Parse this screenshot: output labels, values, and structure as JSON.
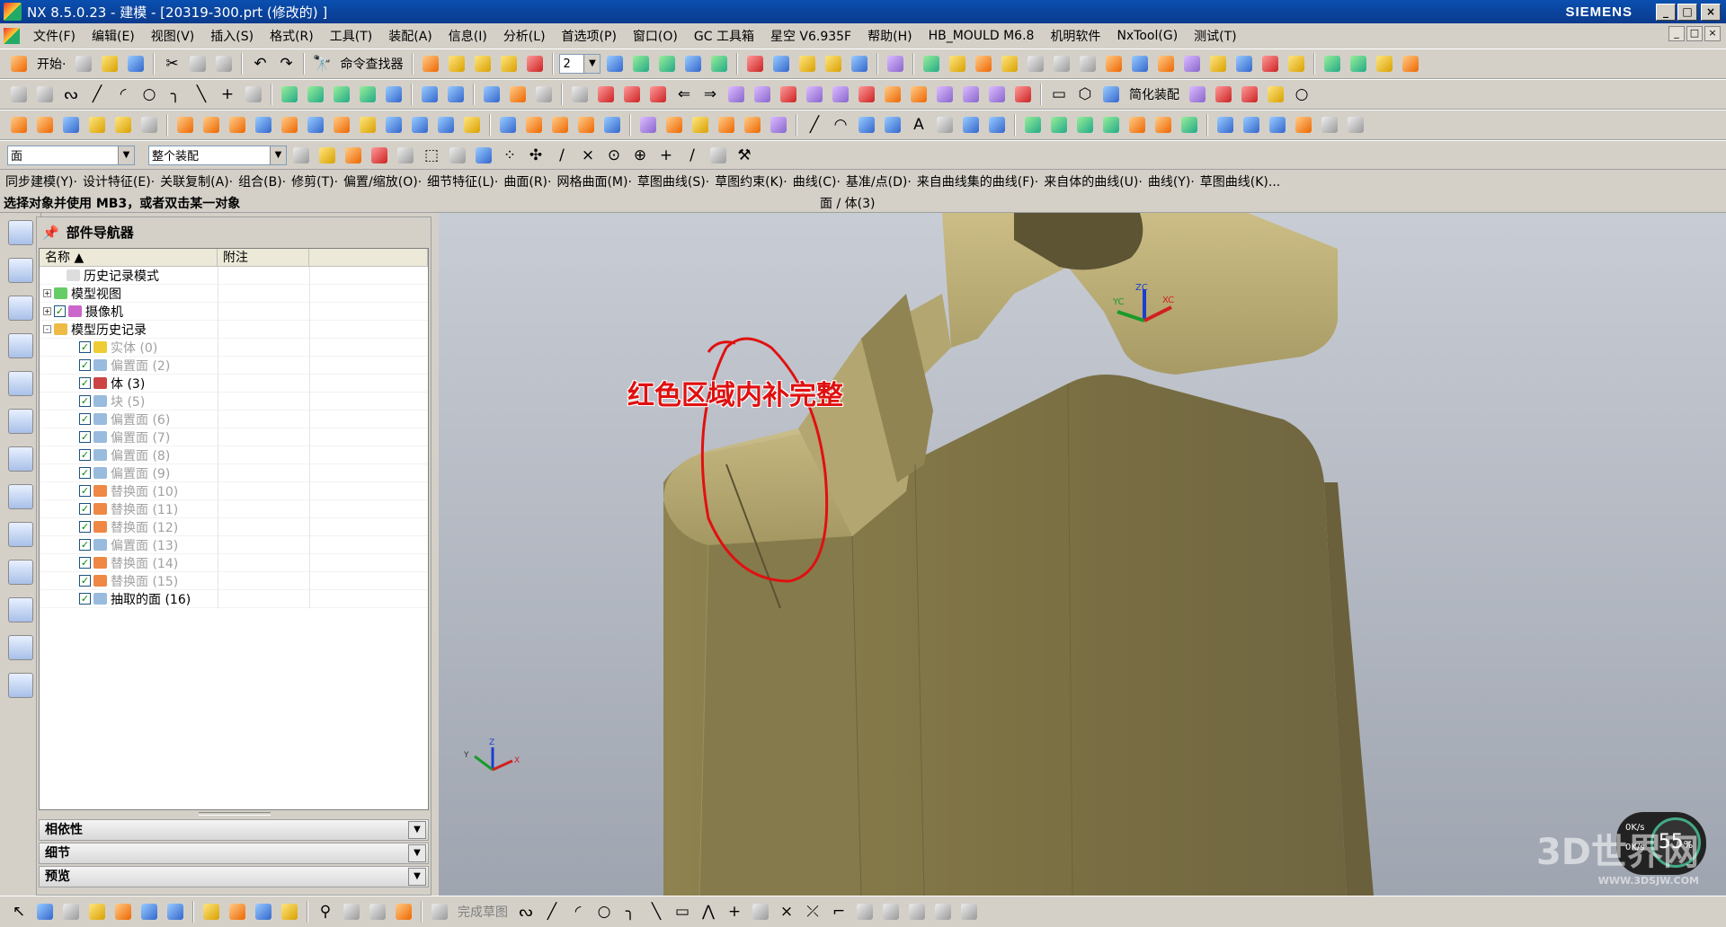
{
  "window": {
    "title": "NX 8.5.0.23 - 建模 - [20319-300.prt (修改的) ]",
    "brand": "SIEMENS",
    "buttons": [
      "_",
      "□",
      "×"
    ]
  },
  "menubar": {
    "items": [
      "文件(F)",
      "编辑(E)",
      "视图(V)",
      "插入(S)",
      "格式(R)",
      "工具(T)",
      "装配(A)",
      "信息(I)",
      "分析(L)",
      "首选项(P)",
      "窗口(O)",
      "GC 工具箱",
      "星空 V6.935F",
      "帮助(H)",
      "HB_MOULD M6.8",
      "机明软件",
      "NxTool(G)",
      "测试(T)"
    ]
  },
  "toolbar1": {
    "start_label": "开始·",
    "command_finder": "命令查找器",
    "layer_value": "2"
  },
  "toolbar2": {
    "simplify_label": "简化装配"
  },
  "filterbar": {
    "type_filter": "面",
    "scope_filter": "整个装配"
  },
  "command_groups": [
    "同步建模(Y)·",
    "设计特征(E)·",
    "关联复制(A)·",
    "组合(B)·",
    "修剪(T)·",
    "偏置/缩放(O)·",
    "细节特征(L)·",
    "曲面(R)·",
    "网格曲面(M)·",
    "草图曲线(S)·",
    "草图约束(K)·",
    "曲线(C)·",
    "基准/点(D)·",
    "来自曲线集的曲线(F)·",
    "来自体的曲线(U)·",
    "曲线(Y)·",
    "草图曲线(K)..."
  ],
  "status": {
    "prompt": "选择对象并使用 MB3，或者双击某一对象",
    "selection": "面 / 体(3)"
  },
  "navigator": {
    "title": "部件导航器",
    "columns": [
      "名称",
      "附注"
    ],
    "rows": [
      {
        "label": "历史记录模式",
        "indent": 1,
        "check": false,
        "icon": "clock-icon",
        "dim": false
      },
      {
        "label": "模型视图",
        "indent": 0,
        "check": false,
        "icon": "model-view-icon",
        "dim": false,
        "expand": "+"
      },
      {
        "label": "摄像机",
        "indent": 0,
        "check": true,
        "icon": "camera-icon",
        "dim": false,
        "expand": "+"
      },
      {
        "label": "模型历史记录",
        "indent": 0,
        "check": false,
        "icon": "folder-icon",
        "dim": false,
        "expand": "-"
      },
      {
        "label": "实体 (0)",
        "indent": 2,
        "check": true,
        "icon": "solid-icon",
        "dim": true
      },
      {
        "label": "偏置面 (2)",
        "indent": 2,
        "check": true,
        "icon": "offset-face-icon",
        "dim": true
      },
      {
        "label": "体 (3)",
        "indent": 2,
        "check": true,
        "icon": "body-icon",
        "dim": false
      },
      {
        "label": "块 (5)",
        "indent": 2,
        "check": true,
        "icon": "block-icon",
        "dim": true
      },
      {
        "label": "偏置面 (6)",
        "indent": 2,
        "check": true,
        "icon": "offset-face-icon",
        "dim": true
      },
      {
        "label": "偏置面 (7)",
        "indent": 2,
        "check": true,
        "icon": "offset-face-icon",
        "dim": true
      },
      {
        "label": "偏置面 (8)",
        "indent": 2,
        "check": true,
        "icon": "offset-face-icon",
        "dim": true
      },
      {
        "label": "偏置面 (9)",
        "indent": 2,
        "check": true,
        "icon": "offset-face-icon",
        "dim": true
      },
      {
        "label": "替换面 (10)",
        "indent": 2,
        "check": true,
        "icon": "replace-face-icon",
        "dim": true
      },
      {
        "label": "替换面 (11)",
        "indent": 2,
        "check": true,
        "icon": "replace-face-icon",
        "dim": true
      },
      {
        "label": "替换面 (12)",
        "indent": 2,
        "check": true,
        "icon": "replace-face-icon",
        "dim": true
      },
      {
        "label": "偏置面 (13)",
        "indent": 2,
        "check": true,
        "icon": "offset-face-icon",
        "dim": true
      },
      {
        "label": "替换面 (14)",
        "indent": 2,
        "check": true,
        "icon": "replace-face-icon",
        "dim": true
      },
      {
        "label": "替换面 (15)",
        "indent": 2,
        "check": true,
        "icon": "replace-face-icon",
        "dim": true
      },
      {
        "label": "抽取的面 (16)",
        "indent": 2,
        "check": true,
        "icon": "extract-face-icon",
        "dim": false
      }
    ],
    "sections": [
      "相依性",
      "细节",
      "预览"
    ]
  },
  "viewport": {
    "annotation": "红色区域内补完整",
    "csys": {
      "zc": "ZC",
      "yc": "YC",
      "xc": "XC"
    },
    "triad": {
      "z": "Z",
      "y": "Y",
      "x": "X"
    },
    "perf": {
      "percent": "55",
      "unit": "%",
      "up": "0K/s",
      "down": "0K/s"
    },
    "watermark": "3D世界网",
    "watermark_url": "WWW.3DSJW.COM"
  },
  "bottombar": {
    "finish_sketch": "完成草图"
  },
  "colors": {
    "model": "#b4a66e",
    "annotation": "#e01010",
    "title_bar": "#0a4fb0"
  }
}
